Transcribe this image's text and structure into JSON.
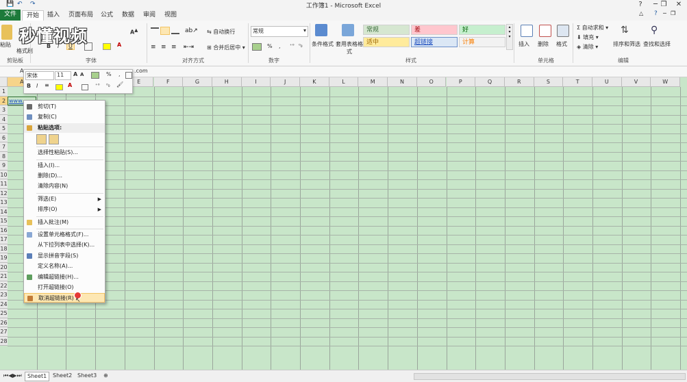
{
  "window": {
    "title": "工作簿1 - Microsoft Excel"
  },
  "quick_access": [
    "💾",
    "↶",
    "↷"
  ],
  "win_controls": [
    "?",
    "─",
    "❐",
    "✕"
  ],
  "ribbon_right_icons": [
    "△",
    "?",
    "─",
    "❐",
    "✕"
  ],
  "tabs": [
    "文件",
    "开始",
    "插入",
    "页面布局",
    "公式",
    "数据",
    "审阅",
    "视图"
  ],
  "active_tab": "开始",
  "groups": {
    "clipboard": {
      "label": "剪贴板",
      "paste": "粘贴",
      "format_painter": "格式刷"
    },
    "font": {
      "label": "字体",
      "name": "宋体",
      "size": "11"
    },
    "alignment": {
      "label": "对齐方式",
      "wrap": "自动换行",
      "merge": "合并后居中"
    },
    "number": {
      "label": "数字",
      "format": "常规",
      "pct": "%",
      "comma": ","
    },
    "styles": {
      "label": "样式",
      "conditional": "条件格式",
      "table": "套用表格格式",
      "cells": [
        {
          "label": "常规",
          "bg": "#d6e7d1",
          "color": "#3a6b3a"
        },
        {
          "label": "差",
          "bg": "#ffc7ce",
          "color": "#9c0006"
        },
        {
          "label": "好",
          "bg": "#c6efce",
          "color": "#006100"
        },
        {
          "label": "适中",
          "bg": "#ffeb9c",
          "color": "#9c6500"
        },
        {
          "label": "超链接",
          "bg": "#dbe7f5",
          "color": "#1f4fbf"
        },
        {
          "label": "计算",
          "bg": "#f2f2f2",
          "color": "#fa7d00"
        }
      ]
    },
    "cells": {
      "label": "单元格",
      "insert": "插入",
      "delete": "删除",
      "format": "格式"
    },
    "editing": {
      "label": "编辑",
      "autosum": "自动求和",
      "fill": "填充",
      "clear": "清除",
      "sort": "排序和筛选",
      "find": "查找和选择"
    }
  },
  "watermark": "秒懂视频",
  "formula_bar": {
    "name_box": "A",
    "content": ".com"
  },
  "mini_toolbar": {
    "font": "宋体",
    "size": "11"
  },
  "columns": [
    "A",
    "B",
    "C",
    "D",
    "E",
    "F",
    "G",
    "H",
    "I",
    "J",
    "K",
    "L",
    "M",
    "N",
    "O",
    "P",
    "Q",
    "R",
    "S",
    "T",
    "U",
    "V",
    "W"
  ],
  "rows": [
    "1",
    "2",
    "3",
    "4",
    "5",
    "6",
    "7",
    "8",
    "9",
    "10",
    "11",
    "12",
    "13",
    "14",
    "15",
    "16",
    "17",
    "18",
    "19",
    "20",
    "21",
    "22",
    "23",
    "24",
    "25",
    "26",
    "27",
    "28"
  ],
  "cell_a2": "www.",
  "context_menu": [
    {
      "label": "剪切(T)",
      "icon": "cut-icon"
    },
    {
      "label": "复制(C)",
      "icon": "copy-icon"
    },
    {
      "label": "粘贴选项:",
      "icon": "paste-icon",
      "header": true
    },
    {
      "label": "",
      "paste_options": true
    },
    {
      "label": "选择性粘贴(S)...",
      "sep_before": true
    },
    {
      "label": "插入(I)...",
      "sep_before": true
    },
    {
      "label": "删除(D)..."
    },
    {
      "label": "清除内容(N)"
    },
    {
      "label": "筛选(E)",
      "submenu": true,
      "sep_before": true
    },
    {
      "label": "排序(O)",
      "submenu": true
    },
    {
      "label": "插入批注(M)",
      "icon": "comment-icon",
      "sep_before": true
    },
    {
      "label": "设置单元格格式(F)...",
      "icon": "format-cells-icon",
      "sep_before": true
    },
    {
      "label": "从下拉列表中选择(K)..."
    },
    {
      "label": "显示拼音字段(S)",
      "icon": "phonetic-icon"
    },
    {
      "label": "定义名称(A)..."
    },
    {
      "label": "编辑超链接(H)...",
      "icon": "edit-link-icon"
    },
    {
      "label": "打开超链接(O)"
    },
    {
      "label": "取消超链接(R)",
      "icon": "remove-link-icon",
      "highlight": true
    }
  ],
  "sheets": [
    "Sheet1",
    "Sheet2",
    "Sheet3"
  ],
  "colors": {
    "grid_bg": "#c8e6c9",
    "accent": "#1d7a3a",
    "highlight": "#fde7b3"
  }
}
